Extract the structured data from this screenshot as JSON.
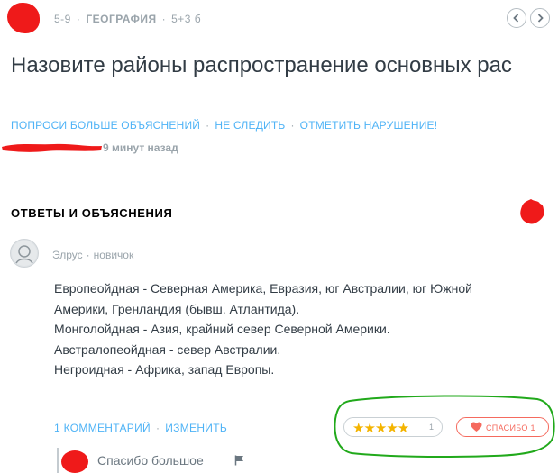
{
  "header": {
    "grade": "5-9",
    "subject": "ГЕОГРАФИЯ",
    "points": "5+3 б",
    "prev_icon": "chevron-left-icon",
    "next_icon": "chevron-right-icon"
  },
  "question": {
    "title": "Назовите районы распространение основных рас",
    "actions": [
      "ПОПРОСИ БОЛЬШЕ ОБЪЯСНЕНИЙ",
      "НЕ СЛЕДИТЬ",
      "ОТМЕТИТЬ НАРУШЕНИЕ!"
    ],
    "time": "9 минут назад"
  },
  "answers_section": {
    "title": "ОТВЕТЫ И ОБЪЯСНЕНИЯ"
  },
  "answer": {
    "author": "Элрус",
    "rank": "новичок",
    "lines": [
      "Европеойдная - Северная Америка, Евразия, юг Австралии, юг Южной",
      "Америки, Гренландия (бывш. Атлантида).",
      "Монголойдная - Азия, крайний север Северной Америки.",
      "Австралопеойдная - север Австралии.",
      "Негроидная - Африка, запад Европы."
    ],
    "comments_link": "1 КОММЕНТАРИЙ",
    "edit_link": "ИЗМЕНИТЬ",
    "rating": {
      "stars": 5,
      "stars_text": "★★★★★",
      "count": "1"
    },
    "thanks": {
      "label": "СПАСИБО",
      "count": "1"
    }
  },
  "comment": {
    "text": "Спасибо большое",
    "flag_icon": "flag-icon"
  },
  "colors": {
    "link": "#4fb3f6",
    "star": "#f4b400",
    "thanks": "#f56a5e",
    "annotation_red": "#ef1a1a",
    "annotation_green": "#21a91b"
  }
}
